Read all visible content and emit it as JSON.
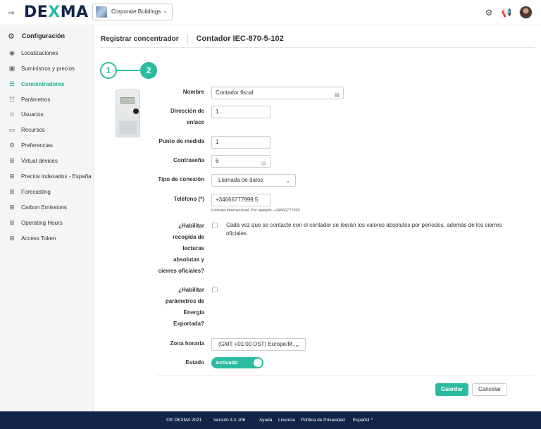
{
  "topbar": {
    "logo_left": "DE",
    "logo_x": "X",
    "logo_right": "MA",
    "building": "Corporate Buildings",
    "menu_icon": "menu-toggle-icon",
    "settings_icon": "gear-icon",
    "announce_icon": "megaphone-icon"
  },
  "sidebar": {
    "heading": "Configuración",
    "items": [
      {
        "label": "Localizaciones",
        "icon": "location-pin-icon"
      },
      {
        "label": "Suministros y precios",
        "icon": "wallet-icon"
      },
      {
        "label": "Concentradores",
        "icon": "concentrator-icon",
        "active": true
      },
      {
        "label": "Parámetros",
        "icon": "sliders-icon"
      },
      {
        "label": "Usuarios",
        "icon": "user-circle-icon"
      },
      {
        "label": "Recursos",
        "icon": "folder-icon"
      },
      {
        "label": "Preferencias",
        "icon": "gear-icon"
      },
      {
        "label": "Virtual devices",
        "icon": "grid-icon"
      },
      {
        "label": "Precios indexados - España",
        "icon": "grid-icon"
      },
      {
        "label": "Forecasting",
        "icon": "grid-icon"
      },
      {
        "label": "Carbon Emissions",
        "icon": "grid-icon"
      },
      {
        "label": "Operating Hours",
        "icon": "grid-icon"
      },
      {
        "label": "Access Token",
        "icon": "grid-icon"
      }
    ]
  },
  "main": {
    "breadcrumb": "Registrar concentrador",
    "title": "Contador IEC-870-5-102",
    "steps": [
      "1",
      "2"
    ],
    "form": {
      "nombre": {
        "label": "Nombre",
        "value": "Contador fiscal"
      },
      "direccion": {
        "label_1": "Dirección de",
        "label_2": "enlace",
        "value": "1"
      },
      "punto": {
        "label": "Punto de medida",
        "value": "1"
      },
      "contrasena": {
        "label": "Contraseña",
        "value": "6"
      },
      "tipo": {
        "label": "Tipo de conexión",
        "value": "Llamada de datos"
      },
      "telefono": {
        "label": "Teléfono (*)",
        "value": "+34666777999 5",
        "hint": "Formato internacional. Por ejemplo, +34666777999"
      },
      "habilitar_recogida": {
        "label_lines": [
          "¿Habilitar",
          "recogida de",
          "lecturas",
          "absolutas y",
          "cierres oficiales?"
        ],
        "help": "Cada vez que se contacte con el contador se leerán los valores absolutos por períodos, además de los cierres oficiales."
      },
      "habilitar_parametros": {
        "label_lines": [
          "¿Habilitar",
          "parámetros de",
          "Energía",
          "Exportada?"
        ]
      },
      "zona": {
        "label": "Zona horaria",
        "value": "(GMT +01:00 DST) Europe/M..."
      },
      "estado": {
        "label": "Estado",
        "value": "Activado"
      }
    },
    "buttons": {
      "save": "Guardar",
      "cancel": "Cancelar"
    }
  },
  "footer": {
    "copyright": "©® DEXMA 2021",
    "version": "Versión 4.2.106",
    "help": "Ayuda",
    "license": "Licencia",
    "privacy": "Política de Privacidad",
    "language": "Español ^"
  }
}
